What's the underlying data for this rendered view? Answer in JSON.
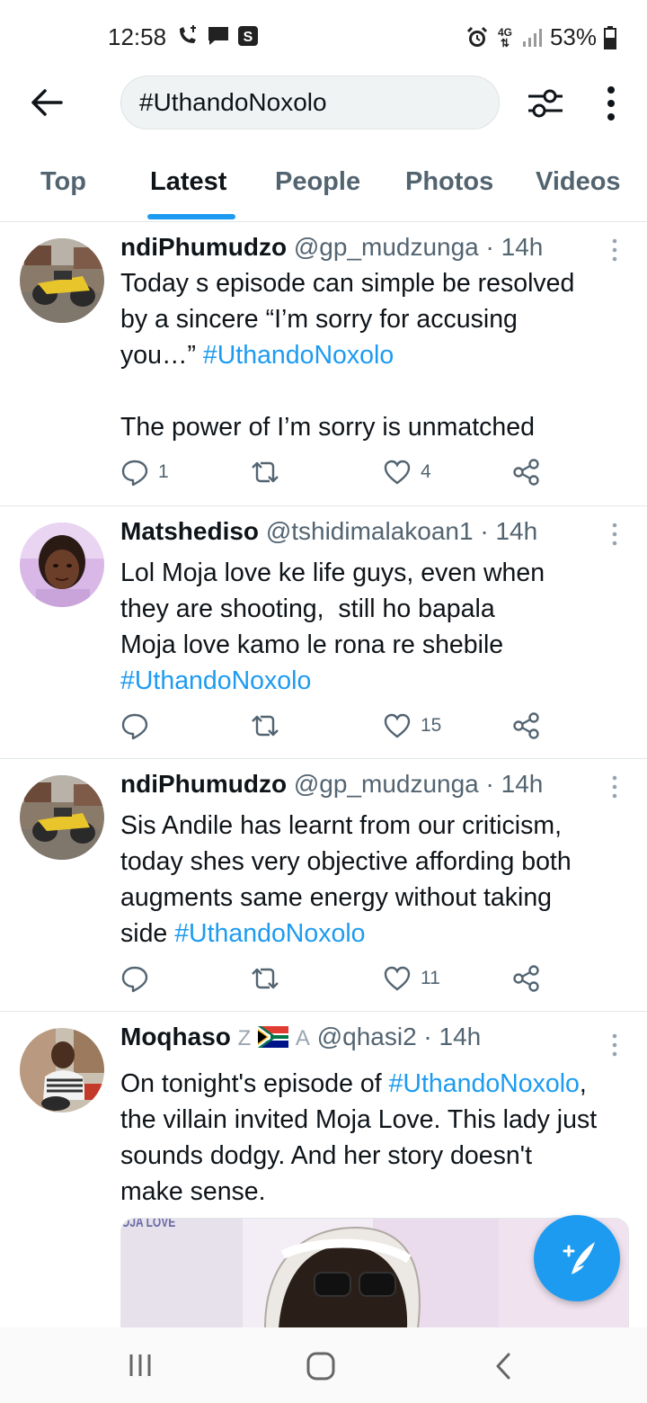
{
  "status_bar": {
    "time": "12:58",
    "network": "4G",
    "battery": "53%",
    "left_icons": [
      "wifi-call-icon",
      "message-icon",
      "s-app-icon"
    ],
    "right_icons": [
      "alarm-icon",
      "network-4g-icon",
      "signal-icon",
      "battery-icon"
    ]
  },
  "header": {
    "search_query": "#UthandoNoxolo",
    "back_icon": "back-arrow-icon",
    "filter_icon": "filter-sliders-icon",
    "more_icon": "more-vertical-icon"
  },
  "tabs": [
    {
      "label": "Top",
      "active": false
    },
    {
      "label": "Latest",
      "active": true
    },
    {
      "label": "People",
      "active": false
    },
    {
      "label": "Photos",
      "active": false
    },
    {
      "label": "Videos",
      "active": false
    }
  ],
  "tweets": [
    {
      "name": "ndiPhumudzo",
      "handle": "@gp_mudzunga",
      "time": "14h",
      "text_lines": [
        "Today s episode can simple be resolved",
        "by a sincere  “I’m sorry for accusing",
        "you…” "
      ],
      "hashtag": "#UthandoNoxolo",
      "text_after": "The power of I’m sorry is unmatched",
      "replies": "1",
      "retweets": "",
      "likes": "4"
    },
    {
      "name": "Matshediso",
      "handle": "@tshidimalakoan1",
      "time": "14h",
      "text_lines": [
        "Lol Moja love ke life guys, even when",
        "they are shooting,  still ho bapala",
        "Moja love kamo le rona re shebile"
      ],
      "hashtag": "#UthandoNoxolo",
      "replies": "",
      "retweets": "",
      "likes": "15"
    },
    {
      "name": "ndiPhumudzo",
      "handle": "@gp_mudzunga",
      "time": "14h",
      "text_lines": [
        "Sis Andile has learnt from our criticism,",
        "today shes very objective affording both",
        "augments same energy without taking",
        "side "
      ],
      "hashtag": "#UthandoNoxolo",
      "replies": "",
      "retweets": "",
      "likes": "11"
    },
    {
      "name": "Moqhaso",
      "name_extras": [
        "Z",
        "A"
      ],
      "handle": "@qhasi2",
      "time": "14h",
      "line1_prefix": "On tonight's episode of ",
      "hashtag": "#UthandoNoxolo",
      "line1_suffix": ",",
      "text_lines": [
        "the villain invited Moja Love. This lady just",
        "sounds dodgy. And her story doesn't",
        "make sense."
      ],
      "media_logo": "OJA LOVE"
    }
  ],
  "fab": {
    "icon": "compose-tweet-icon",
    "label": "+"
  },
  "nav": {
    "icons": [
      "recent-apps-icon",
      "home-icon",
      "back-icon"
    ]
  },
  "colors": {
    "accent": "#1d9bf0",
    "text": "#0f1419",
    "muted": "#536471",
    "divider": "#e3e6e8"
  }
}
